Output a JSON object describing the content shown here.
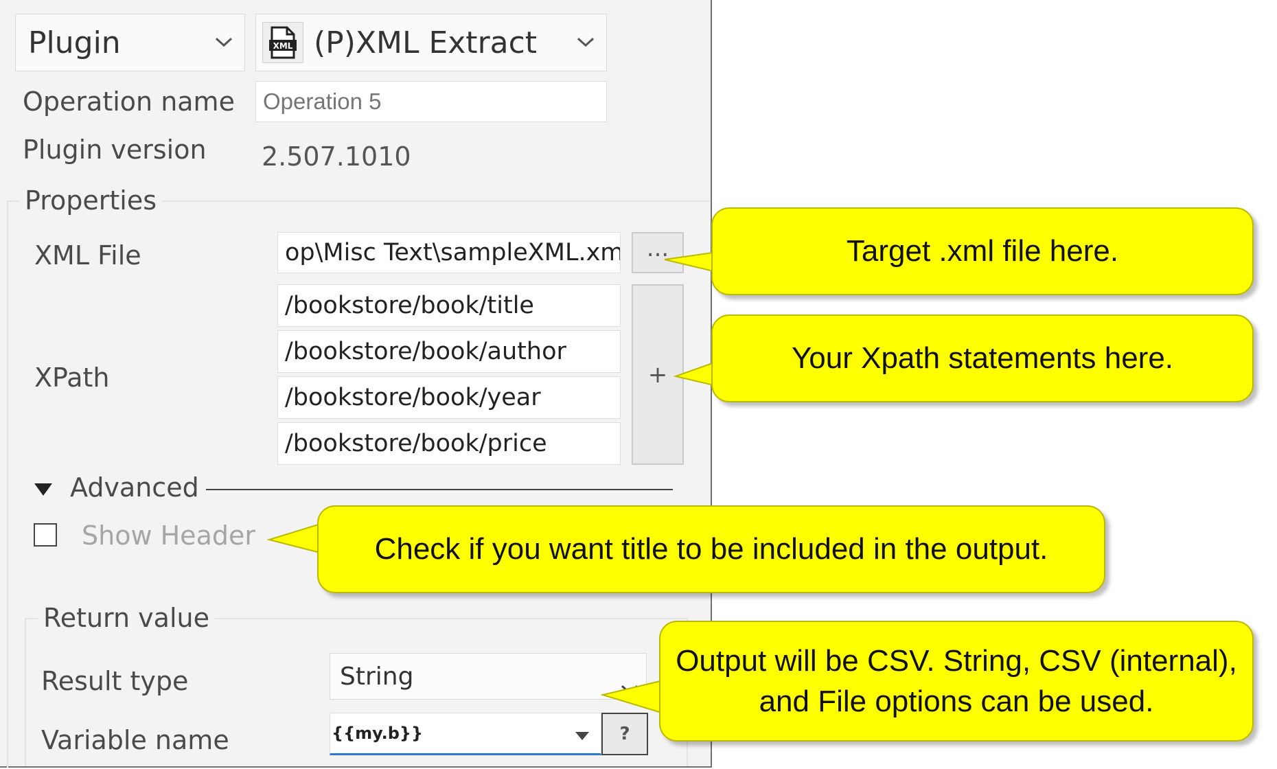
{
  "header": {
    "category": {
      "value": "Plugin"
    },
    "plugin": {
      "value": "(P)XML Extract",
      "icon": "xml-file-icon",
      "icon_text": "XML"
    }
  },
  "operation": {
    "name_label": "Operation name",
    "name_placeholder": "Operation 5",
    "version_label": "Plugin version",
    "version_value": "2.507.1010"
  },
  "properties": {
    "title": "Properties",
    "xml_file_label": "XML File",
    "xml_file_value": "op\\Misc Text\\sampleXML.xml",
    "browse_label": "...",
    "xpath_label": "XPath",
    "xpaths": [
      "/bookstore/book/title",
      "/bookstore/book/author",
      "/bookstore/book/year",
      "/bookstore/book/price"
    ],
    "add_label": "+"
  },
  "advanced": {
    "title": "Advanced",
    "show_header_label": "Show Header",
    "show_header_checked": false
  },
  "return_value": {
    "title": "Return value",
    "result_type_label": "Result type",
    "result_type_value": "String",
    "variable_name_label": "Variable name",
    "variable_name_value": "{{my.b}}",
    "help_label": "?"
  },
  "callouts": [
    "Target .xml file here.",
    "Your Xpath statements here.",
    "Check if you want title to be included in the output.",
    "Output will be CSV. String, CSV (internal), and File options can be used."
  ],
  "colors": {
    "callout_fill": "#ffff00",
    "panel_bg": "#f3f3f3"
  }
}
